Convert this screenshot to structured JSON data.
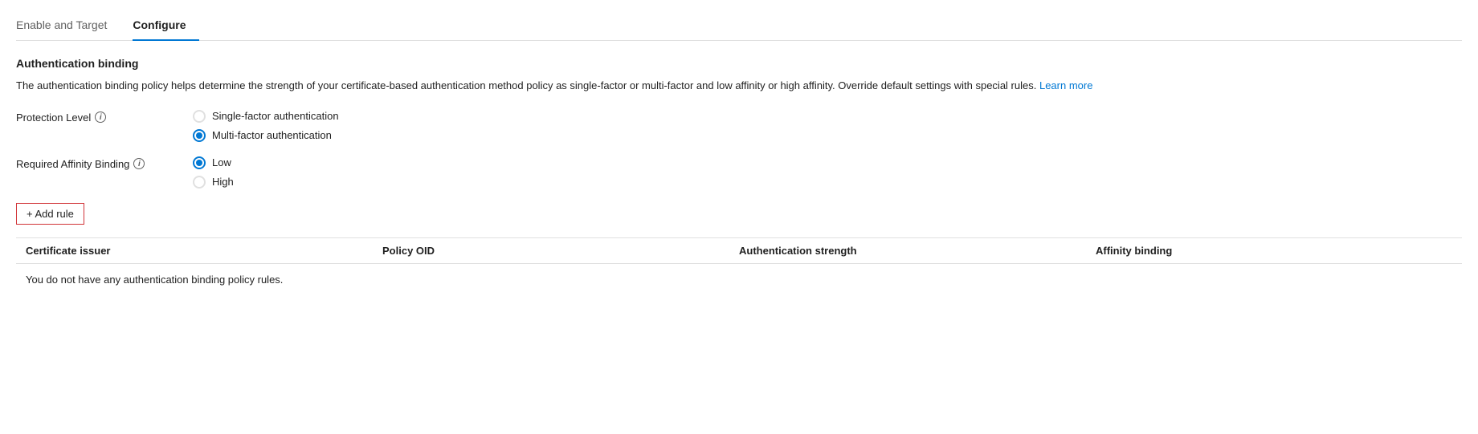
{
  "tabs": [
    {
      "id": "enable-target",
      "label": "Enable and Target",
      "active": false
    },
    {
      "id": "configure",
      "label": "Configure",
      "active": true
    }
  ],
  "section": {
    "title": "Authentication binding",
    "description": "The authentication binding policy helps determine the strength of your certificate-based authentication method policy as single-factor or multi-factor and low affinity or high affinity. Override default settings with special rules.",
    "learn_more_label": "Learn more"
  },
  "protection_level": {
    "label": "Protection Level",
    "options": [
      {
        "id": "single-factor",
        "label": "Single-factor authentication",
        "selected": false
      },
      {
        "id": "multi-factor",
        "label": "Multi-factor authentication",
        "selected": true
      }
    ]
  },
  "affinity_binding": {
    "label": "Required Affinity Binding",
    "options": [
      {
        "id": "low",
        "label": "Low",
        "selected": true
      },
      {
        "id": "high",
        "label": "High",
        "selected": false
      }
    ]
  },
  "add_rule_button": {
    "label": "+ Add rule"
  },
  "table": {
    "columns": [
      {
        "id": "certificate-issuer",
        "label": "Certificate issuer"
      },
      {
        "id": "policy-oid",
        "label": "Policy OID"
      },
      {
        "id": "auth-strength",
        "label": "Authentication strength"
      },
      {
        "id": "affinity-binding",
        "label": "Affinity binding"
      }
    ],
    "empty_message": "You do not have any authentication binding policy rules."
  }
}
